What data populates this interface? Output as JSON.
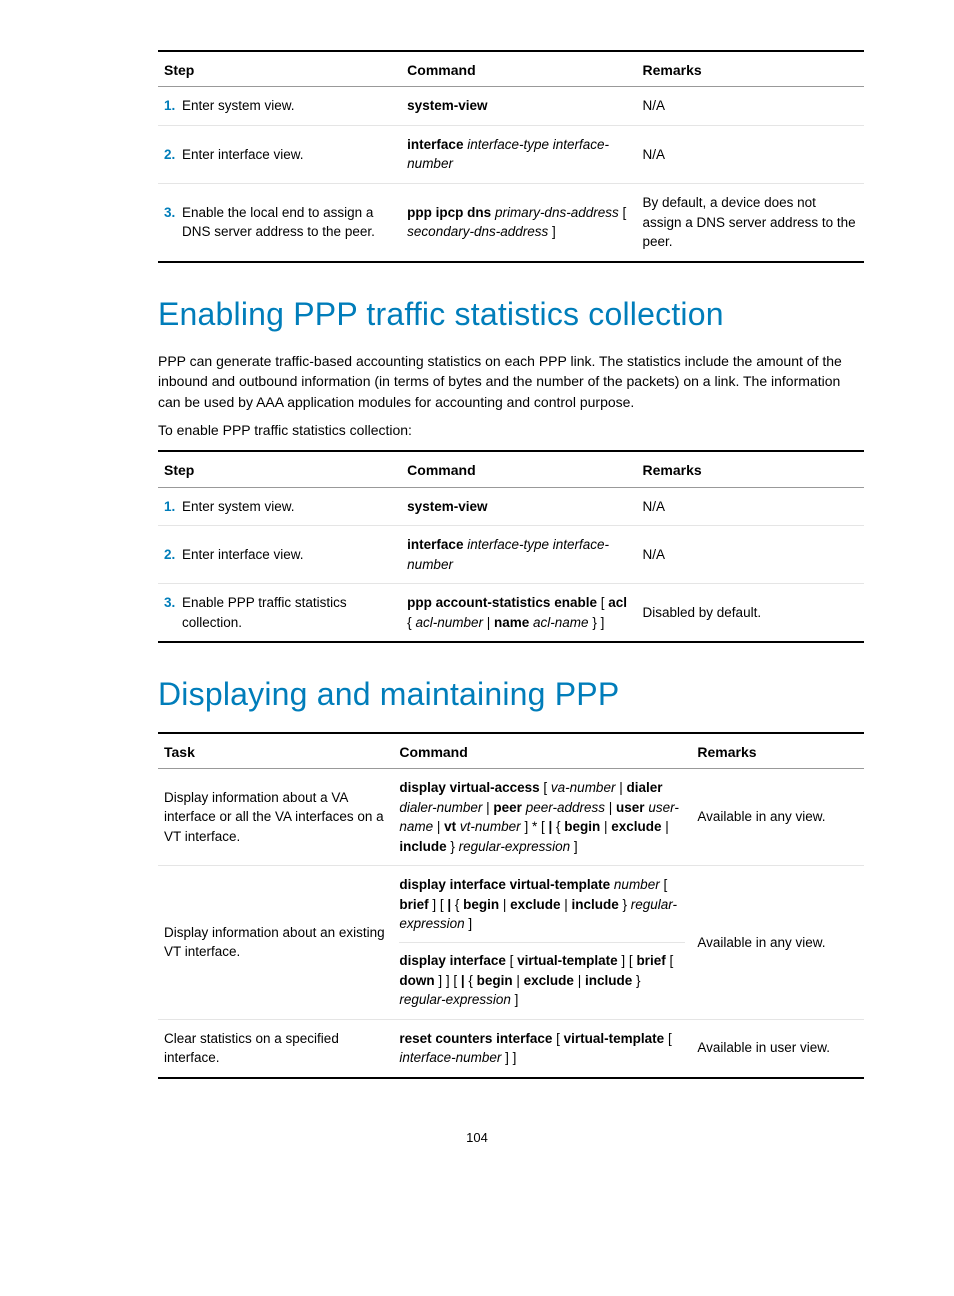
{
  "table1": {
    "headers": [
      "Step",
      "Command",
      "Remarks"
    ],
    "rows": [
      {
        "num": "1.",
        "step": "Enter system view.",
        "cmd": [
          {
            "b": true,
            "t": "system-view"
          }
        ],
        "rem": "N/A"
      },
      {
        "num": "2.",
        "step": "Enter interface view.",
        "cmd": [
          {
            "b": true,
            "t": "interface"
          },
          {
            "t": " "
          },
          {
            "i": true,
            "t": "interface-type interface-number"
          }
        ],
        "rem": "N/A"
      },
      {
        "num": "3.",
        "step": "Enable the local end to assign a DNS server address to the peer.",
        "cmd": [
          {
            "b": true,
            "t": "ppp ipcp dns"
          },
          {
            "t": " "
          },
          {
            "i": true,
            "t": "primary-dns-address"
          },
          {
            "t": " [ "
          },
          {
            "i": true,
            "t": "secondary-dns-address"
          },
          {
            "t": " ]"
          }
        ],
        "rem": "By default, a device does not assign a DNS server address to the peer."
      }
    ]
  },
  "h1": "Enabling PPP traffic statistics collection",
  "p1": "PPP can generate traffic-based accounting statistics on each PPP link. The statistics include the amount of the inbound and outbound information (in terms of bytes and the number of the packets) on a link. The information can be used by AAA application modules for accounting and control purpose.",
  "p2": "To enable PPP traffic statistics collection:",
  "table2": {
    "headers": [
      "Step",
      "Command",
      "Remarks"
    ],
    "rows": [
      {
        "num": "1.",
        "step": "Enter system view.",
        "cmd": [
          {
            "b": true,
            "t": "system-view"
          }
        ],
        "rem": "N/A"
      },
      {
        "num": "2.",
        "step": "Enter interface view.",
        "cmd": [
          {
            "b": true,
            "t": "interface"
          },
          {
            "t": " "
          },
          {
            "i": true,
            "t": "interface-type interface-number"
          }
        ],
        "rem": "N/A"
      },
      {
        "num": "3.",
        "step": "Enable PPP traffic statistics collection.",
        "cmd": [
          {
            "b": true,
            "t": "ppp account-statistics enable"
          },
          {
            "t": " [ "
          },
          {
            "b": true,
            "t": "acl"
          },
          {
            "t": " { "
          },
          {
            "i": true,
            "t": "acl-number"
          },
          {
            "t": " | "
          },
          {
            "b": true,
            "t": "name"
          },
          {
            "t": " "
          },
          {
            "i": true,
            "t": "acl-name"
          },
          {
            "t": " } ]"
          }
        ],
        "rem": "Disabled by default."
      }
    ]
  },
  "h2": "Displaying and maintaining PPP",
  "table3": {
    "headers": [
      "Task",
      "Command",
      "Remarks"
    ],
    "rows": [
      {
        "task": "Display information about a VA interface or all the VA interfaces on a VT interface.",
        "cmd": [
          {
            "b": true,
            "t": "display virtual-access"
          },
          {
            "t": " [ "
          },
          {
            "i": true,
            "t": "va-number"
          },
          {
            "t": " | "
          },
          {
            "b": true,
            "t": "dialer"
          },
          {
            "t": " "
          },
          {
            "i": true,
            "t": "dialer-number"
          },
          {
            "t": " | "
          },
          {
            "b": true,
            "t": "peer"
          },
          {
            "t": " "
          },
          {
            "i": true,
            "t": "peer-address"
          },
          {
            "t": " | "
          },
          {
            "b": true,
            "t": "user"
          },
          {
            "t": " "
          },
          {
            "i": true,
            "t": "user-name"
          },
          {
            "t": " | "
          },
          {
            "b": true,
            "t": "vt"
          },
          {
            "t": " "
          },
          {
            "i": true,
            "t": "vt-number"
          },
          {
            "t": " ] * [ "
          },
          {
            "b": true,
            "t": "|"
          },
          {
            "t": " { "
          },
          {
            "b": true,
            "t": "begin"
          },
          {
            "t": " | "
          },
          {
            "b": true,
            "t": "exclude"
          },
          {
            "t": " | "
          },
          {
            "b": true,
            "t": "include"
          },
          {
            "t": " } "
          },
          {
            "i": true,
            "t": "regular-expression"
          },
          {
            "t": " ]"
          }
        ],
        "rem": "Available in any view."
      },
      {
        "task": "Display information about an existing VT interface.",
        "cmd_multi": [
          [
            {
              "b": true,
              "t": "display interface virtual-template"
            },
            {
              "t": " "
            },
            {
              "i": true,
              "t": "number"
            },
            {
              "t": " [ "
            },
            {
              "b": true,
              "t": "brief"
            },
            {
              "t": " ] [ "
            },
            {
              "b": true,
              "t": "|"
            },
            {
              "t": " { "
            },
            {
              "b": true,
              "t": "begin"
            },
            {
              "t": " | "
            },
            {
              "b": true,
              "t": "exclude"
            },
            {
              "t": " | "
            },
            {
              "b": true,
              "t": "include"
            },
            {
              "t": " } "
            },
            {
              "i": true,
              "t": "regular-expression"
            },
            {
              "t": " ]"
            }
          ],
          [
            {
              "b": true,
              "t": "display interface"
            },
            {
              "t": " [ "
            },
            {
              "b": true,
              "t": "virtual-template"
            },
            {
              "t": " ] [ "
            },
            {
              "b": true,
              "t": "brief"
            },
            {
              "t": " [ "
            },
            {
              "b": true,
              "t": "down"
            },
            {
              "t": " ] ] [ "
            },
            {
              "b": true,
              "t": "|"
            },
            {
              "t": " { "
            },
            {
              "b": true,
              "t": "begin"
            },
            {
              "t": " | "
            },
            {
              "b": true,
              "t": "exclude"
            },
            {
              "t": " | "
            },
            {
              "b": true,
              "t": "include"
            },
            {
              "t": " } "
            },
            {
              "i": true,
              "t": "regular-expression"
            },
            {
              "t": " ]"
            }
          ]
        ],
        "rem": "Available in any view."
      },
      {
        "task": "Clear statistics on a specified interface.",
        "cmd": [
          {
            "b": true,
            "t": "reset counters interface"
          },
          {
            "t": " [ "
          },
          {
            "b": true,
            "t": "virtual-template"
          },
          {
            "t": " [ "
          },
          {
            "i": true,
            "t": "interface-number"
          },
          {
            "t": " ] ]"
          }
        ],
        "rem": "Available in user view."
      }
    ]
  },
  "page": "104"
}
